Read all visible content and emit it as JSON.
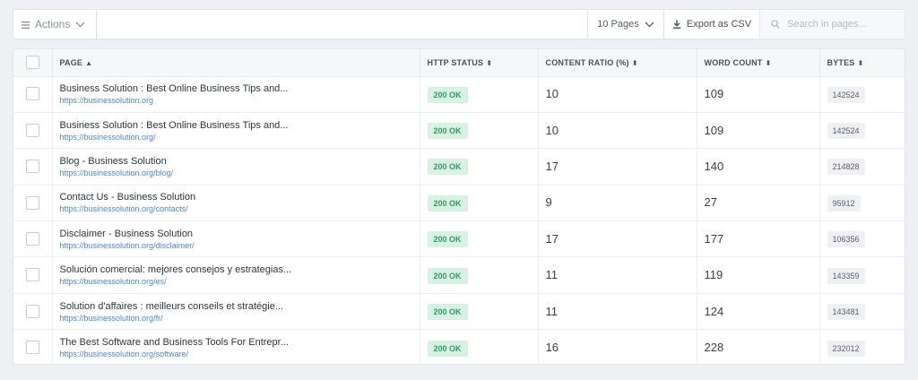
{
  "toolbar": {
    "actions_label": "Actions",
    "pages_label": "10 Pages",
    "export_label": "Export as CSV",
    "search_placeholder": "Search in pages..."
  },
  "table": {
    "columns": {
      "page": "PAGE",
      "http_status": "HTTP STATUS",
      "content_ratio": "CONTENT RATIO (%)",
      "word_count": "WORD COUNT",
      "bytes": "BYTES"
    },
    "rows": [
      {
        "title": "Business Solution : Best Online Business Tips and...",
        "url": "https://businessolution.org",
        "status": "200 OK",
        "content_ratio": "10",
        "word_count": "109",
        "bytes": "142524"
      },
      {
        "title": "Business Solution : Best Online Business Tips and...",
        "url": "https://businessolution.org/",
        "status": "200 OK",
        "content_ratio": "10",
        "word_count": "109",
        "bytes": "142524"
      },
      {
        "title": "Blog - Business Solution",
        "url": "https://businessolution.org/blog/",
        "status": "200 OK",
        "content_ratio": "17",
        "word_count": "140",
        "bytes": "214828"
      },
      {
        "title": "Contact Us - Business Solution",
        "url": "https://businessolution.org/contacts/",
        "status": "200 OK",
        "content_ratio": "9",
        "word_count": "27",
        "bytes": "95912"
      },
      {
        "title": "Disclaimer - Business Solution",
        "url": "https://businessolution.org/disclaimer/",
        "status": "200 OK",
        "content_ratio": "17",
        "word_count": "177",
        "bytes": "106356"
      },
      {
        "title": "Solución comercial: mejores consejos y estrategias...",
        "url": "https://businessolution.org/es/",
        "status": "200 OK",
        "content_ratio": "11",
        "word_count": "119",
        "bytes": "143359"
      },
      {
        "title": "Solution d'affaires : meilleurs conseils et stratégie...",
        "url": "https://businessolution.org/fr/",
        "status": "200 OK",
        "content_ratio": "11",
        "word_count": "124",
        "bytes": "143481"
      },
      {
        "title": "The Best Software and Business Tools For Entrepr...",
        "url": "https://businessolution.org/software/",
        "status": "200 OK",
        "content_ratio": "16",
        "word_count": "228",
        "bytes": "232012"
      }
    ]
  },
  "colors": {
    "status_bg": "#d7f2e3",
    "status_text": "#2f9d66",
    "link": "#4a86d6"
  },
  "icons": {
    "actions": "menu-lines-icon",
    "dropdown": "chevron-down-icon",
    "export": "download-icon",
    "search": "search-icon",
    "sort_asc": "sort-asc-icon",
    "sort_both": "sort-both-icon"
  }
}
